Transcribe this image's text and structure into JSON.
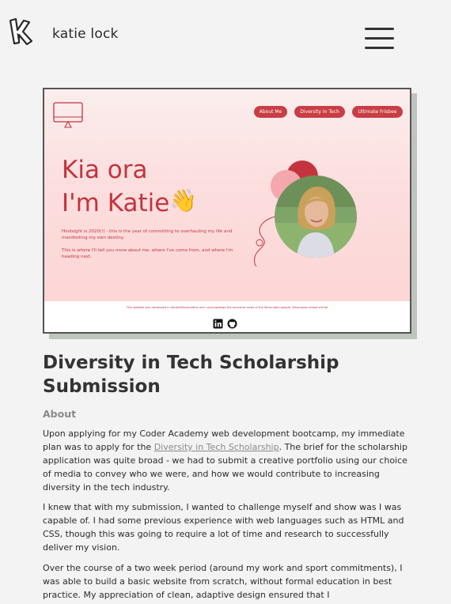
{
  "site": {
    "name": "katie lock"
  },
  "screenshot": {
    "nav": [
      "About Me",
      "Diversity In Tech",
      "Ultimate Frisbee"
    ],
    "heading_line1": "Kia ora",
    "heading_line2": "I'm Katie",
    "wave_emoji": "👋",
    "intro_1": "Hindsight is 2020(!) - this is the year of committing to overhauling my life and manifesting my own destiny.",
    "intro_2": "This is where I'll tell you more about me, where I've come from, and where I'm heading next.",
    "footer": "This website was developed in Aoraki/Mauinutdina and I acknowledge the ancestral lands of the Wurundjeri people. Whanawau ahead will be",
    "icons": [
      "linkedin-icon",
      "github-icon"
    ]
  },
  "article": {
    "title": "Diversity in Tech Scholarship Submission",
    "section": "About",
    "p1_before": "Upon applying for my Coder Academy web development bootcamp, my immediate plan was to apply for the ",
    "p1_link": "Diversity in Tech Scholarship",
    "p1_after": ". The brief for the scholarship application was quite broad - we had to submit a creative portfolio using our choice of media to convey who we were, and how we would contribute to increasing diversity in the tech industry.",
    "p2": "I knew that with my submission, I wanted to challenge myself and show was I was capable of. I had some previous experience with web languages such as HTML and CSS, though this was going to require a lot of time and research to successfully deliver my vision.",
    "p3": "Over the course of a two week period (around my work and sport commitments), I was able to build a basic website from scratch, without formal education in best practice. My appreciation of clean, adaptive design ensured that I"
  },
  "colors": {
    "accent": "#c3343e",
    "pill": "#c93d44",
    "hero_bg": "#fcdede"
  }
}
